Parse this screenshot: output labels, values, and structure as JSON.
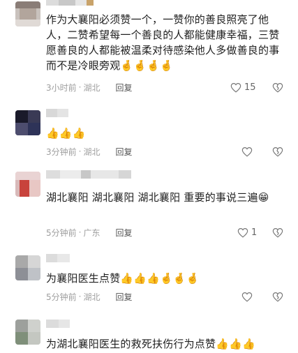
{
  "comments": [
    {
      "text": "作为大襄阳必须赞一个，一赞你的善良照亮了他人，二赞希望每一个善良的人都能健康幸福，三赞愿善良的人都能被温柔对待感染他人多做善良的事而不是冷眼旁观🤞🤞🤞🤞",
      "time": "3小时前",
      "location": "湖北",
      "reply_label": "回复",
      "like_count": "15"
    },
    {
      "text": "👍👍👍",
      "time": "3分钟前",
      "location": "湖北",
      "reply_label": "回复",
      "like_count": ""
    },
    {
      "text": "湖北襄阳 湖北襄阳 湖北襄阳 重要的事说三遍😁",
      "time": "5分钟前",
      "location": "广东",
      "reply_label": "回复",
      "like_count": "1"
    },
    {
      "text": "为襄阳医生点赞👍👍👍🤞🤞🤞",
      "time": "5分钟前",
      "location": "湖北",
      "reply_label": "回复",
      "like_count": ""
    },
    {
      "text": "为湖北襄阳医生的救死扶伤行为点赞👍👍👍",
      "time": "",
      "location": "",
      "reply_label": "",
      "like_count": ""
    }
  ],
  "meta_separator": "·",
  "icons": {
    "like": "heart-outline-icon",
    "dislike": "broken-heart-icon"
  },
  "colors": {
    "text": "#1f1f1f",
    "meta": "#9e9e9e",
    "icon": "#777777"
  }
}
